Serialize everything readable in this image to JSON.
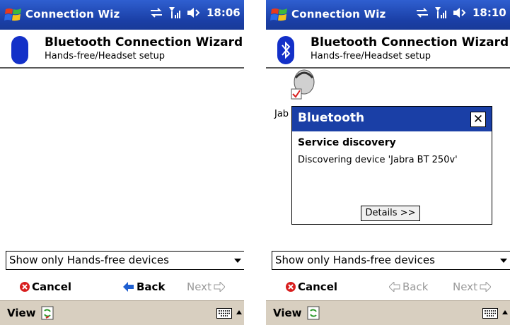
{
  "screens": [
    {
      "title": "Connection Wiz",
      "time": "18:06",
      "header_title": "Bluetooth Connection Wizard",
      "header_subtitle": "Hands-free/Headset setup",
      "filter_value": "Show only Hands-free devices",
      "cancel_label": "Cancel",
      "back_label": "Back",
      "next_label": "Next",
      "menu_view": "View"
    },
    {
      "title": "Connection Wiz",
      "time": "18:10",
      "header_title": "Bluetooth Connection Wizard",
      "header_subtitle": "Hands-free/Headset setup",
      "device_label": "Jab",
      "dialog": {
        "title": "Bluetooth",
        "close": "✕",
        "heading": "Service discovery",
        "message": "Discovering device 'Jabra BT 250v'",
        "details_button": "Details >>"
      },
      "filter_value": "Show only Hands-free devices",
      "cancel_label": "Cancel",
      "back_label": "Back",
      "next_label": "Next",
      "menu_view": "View"
    }
  ],
  "colors": {
    "titlebar": "#1a3fa6",
    "menubar": "#d8cfc0",
    "cancel_icon": "#d81e1e",
    "back_icon": "#1f5fd0"
  }
}
